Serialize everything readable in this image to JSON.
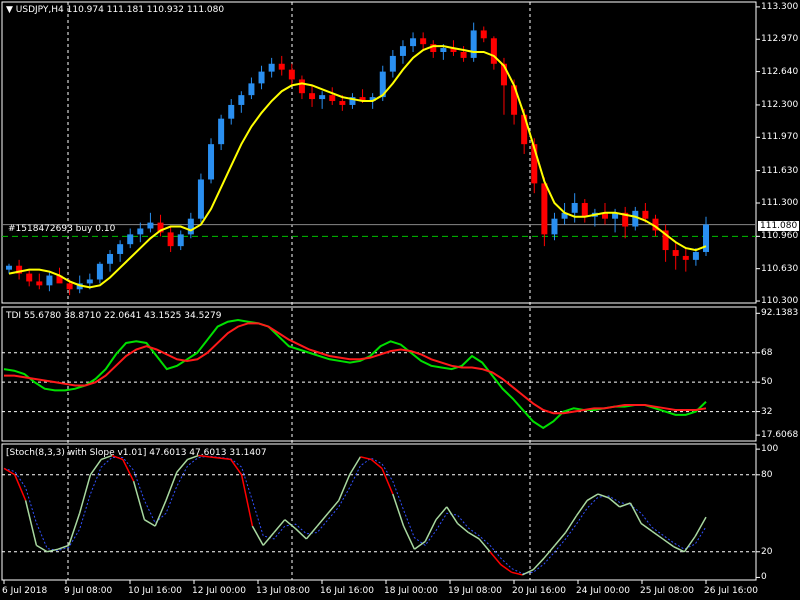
{
  "header": {
    "symbol": "USDJPY,H4",
    "ohlc": "110.974 111.181 110.932 111.080"
  },
  "order_label": "#1518472693 buy 0.10",
  "current_price": "111.080",
  "colors": {
    "bull": "#2a8ff0",
    "bear": "#ff0000",
    "ma": "#ffff00",
    "tdi_green": "#00e000",
    "tdi_red": "#ff1a1a",
    "stoch": "#a8d8a0",
    "signal": "#3050ff",
    "grid": "#ffffff"
  },
  "chart_data": [
    {
      "type": "candlestick",
      "title": "USDJPY,H4",
      "y_ticks": [
        "113.300",
        "112.970",
        "112.640",
        "112.300",
        "111.970",
        "111.630",
        "111.300",
        "110.960",
        "110.630",
        "110.300"
      ],
      "ylim": [
        110.28,
        113.35
      ],
      "candles": [
        [
          110.62,
          110.68,
          110.58,
          110.66
        ],
        [
          110.66,
          110.72,
          110.52,
          110.58
        ],
        [
          110.58,
          110.62,
          110.45,
          110.5
        ],
        [
          110.5,
          110.58,
          110.42,
          110.46
        ],
        [
          110.46,
          110.6,
          110.4,
          110.56
        ],
        [
          110.56,
          110.64,
          110.5,
          110.48
        ],
        [
          110.48,
          110.52,
          110.36,
          110.42
        ],
        [
          110.42,
          110.56,
          110.38,
          110.48
        ],
        [
          110.48,
          110.58,
          110.42,
          110.52
        ],
        [
          110.52,
          110.7,
          110.48,
          110.68
        ],
        [
          110.68,
          110.82,
          110.6,
          110.78
        ],
        [
          110.78,
          110.92,
          110.7,
          110.88
        ],
        [
          110.88,
          111.04,
          110.84,
          110.98
        ],
        [
          110.98,
          111.1,
          110.9,
          111.04
        ],
        [
          111.04,
          111.2,
          111.0,
          111.1
        ],
        [
          111.1,
          111.18,
          110.96,
          111.0
        ],
        [
          111.0,
          111.06,
          110.8,
          110.86
        ],
        [
          110.86,
          111.02,
          110.82,
          110.98
        ],
        [
          110.98,
          111.2,
          110.94,
          111.14
        ],
        [
          111.14,
          111.6,
          111.1,
          111.54
        ],
        [
          111.54,
          111.96,
          111.5,
          111.9
        ],
        [
          111.9,
          112.2,
          111.84,
          112.16
        ],
        [
          112.16,
          112.36,
          112.1,
          112.3
        ],
        [
          112.3,
          112.44,
          112.22,
          112.4
        ],
        [
          112.4,
          112.58,
          112.36,
          112.52
        ],
        [
          112.52,
          112.7,
          112.46,
          112.64
        ],
        [
          112.64,
          112.78,
          112.58,
          112.72
        ],
        [
          112.72,
          112.8,
          112.6,
          112.66
        ],
        [
          112.66,
          112.72,
          112.5,
          112.56
        ],
        [
          112.56,
          112.6,
          112.36,
          112.42
        ],
        [
          112.42,
          112.5,
          112.28,
          112.36
        ],
        [
          112.36,
          112.44,
          112.26,
          112.4
        ],
        [
          112.4,
          112.48,
          112.3,
          112.34
        ],
        [
          112.34,
          112.4,
          112.24,
          112.3
        ],
        [
          112.3,
          112.42,
          112.26,
          112.38
        ],
        [
          112.38,
          112.46,
          112.32,
          112.34
        ],
        [
          112.34,
          112.42,
          112.26,
          112.38
        ],
        [
          112.38,
          112.7,
          112.34,
          112.64
        ],
        [
          112.64,
          112.86,
          112.58,
          112.8
        ],
        [
          112.8,
          112.96,
          112.72,
          112.9
        ],
        [
          112.9,
          113.04,
          112.84,
          112.98
        ],
        [
          112.98,
          113.04,
          112.86,
          112.92
        ],
        [
          112.92,
          112.96,
          112.78,
          112.84
        ],
        [
          112.84,
          112.92,
          112.76,
          112.88
        ],
        [
          112.88,
          112.96,
          112.8,
          112.84
        ],
        [
          112.84,
          112.9,
          112.74,
          112.78
        ],
        [
          112.78,
          113.14,
          112.74,
          113.06
        ],
        [
          113.06,
          113.1,
          112.94,
          112.98
        ],
        [
          112.98,
          113.0,
          112.66,
          112.72
        ],
        [
          112.72,
          112.78,
          112.2,
          112.5
        ],
        [
          112.5,
          112.56,
          112.1,
          112.2
        ],
        [
          112.2,
          112.26,
          111.8,
          111.9
        ],
        [
          111.9,
          111.96,
          111.4,
          111.5
        ],
        [
          111.5,
          111.56,
          110.86,
          110.98
        ],
        [
          110.98,
          111.2,
          110.92,
          111.14
        ],
        [
          111.14,
          111.3,
          111.08,
          111.2
        ],
        [
          111.2,
          111.4,
          111.1,
          111.3
        ],
        [
          111.3,
          111.34,
          111.1,
          111.16
        ],
        [
          111.16,
          111.24,
          111.06,
          111.2
        ],
        [
          111.2,
          111.3,
          111.08,
          111.14
        ],
        [
          111.14,
          111.24,
          111.0,
          111.2
        ],
        [
          111.2,
          111.26,
          110.94,
          111.06
        ],
        [
          111.06,
          111.26,
          111.02,
          111.22
        ],
        [
          111.22,
          111.3,
          111.1,
          111.14
        ],
        [
          111.14,
          111.18,
          110.96,
          111.02
        ],
        [
          111.02,
          111.08,
          110.7,
          110.82
        ],
        [
          110.82,
          110.9,
          110.62,
          110.76
        ],
        [
          110.76,
          110.84,
          110.6,
          110.72
        ],
        [
          110.72,
          110.84,
          110.66,
          110.8
        ],
        [
          110.8,
          111.16,
          110.76,
          111.08
        ]
      ],
      "ma": [
        110.58,
        110.6,
        110.62,
        110.62,
        110.6,
        110.56,
        110.5,
        110.46,
        110.44,
        110.46,
        110.54,
        110.64,
        110.74,
        110.84,
        110.94,
        111.02,
        111.06,
        111.06,
        111.02,
        111.08,
        111.24,
        111.46,
        111.68,
        111.9,
        112.08,
        112.22,
        112.34,
        112.44,
        112.5,
        112.52,
        112.5,
        112.46,
        112.42,
        112.38,
        112.36,
        112.34,
        112.34,
        112.4,
        112.52,
        112.66,
        112.78,
        112.86,
        112.9,
        112.9,
        112.88,
        112.86,
        112.84,
        112.84,
        112.8,
        112.7,
        112.5,
        112.2,
        111.86,
        111.52,
        111.3,
        111.2,
        111.16,
        111.16,
        111.18,
        111.2,
        111.2,
        111.18,
        111.16,
        111.12,
        111.06,
        110.98,
        110.9,
        110.84,
        110.82,
        110.86
      ]
    },
    {
      "type": "line",
      "title": "TDI 55.6780 38.8710 22.0641 43.1525 34.5279",
      "y_ticks": [
        "92.1383",
        "68",
        "50",
        "32",
        "17.6068"
      ],
      "ylim": [
        14,
        96
      ],
      "series": [
        {
          "values": [
            58,
            57,
            55,
            50,
            46,
            45,
            45,
            46,
            48,
            52,
            58,
            67,
            74,
            75,
            74,
            66,
            58,
            60,
            64,
            68,
            76,
            84,
            87,
            88,
            87,
            86,
            84,
            78,
            72,
            70,
            68,
            66,
            64,
            63,
            62,
            63,
            66,
            72,
            75,
            73,
            68,
            63,
            60,
            59,
            58,
            60,
            66,
            62,
            54,
            46,
            40,
            33,
            26,
            22,
            26,
            32,
            34,
            33,
            33,
            34,
            35,
            35,
            36,
            36,
            34,
            32,
            30,
            30,
            32,
            38
          ]
        },
        {
          "values": [
            54,
            54,
            53,
            52,
            51,
            50,
            49,
            48,
            48,
            50,
            54,
            60,
            66,
            70,
            72,
            70,
            67,
            64,
            63,
            64,
            68,
            74,
            80,
            84,
            86,
            86,
            84,
            80,
            76,
            73,
            70,
            68,
            66,
            65,
            64,
            64,
            65,
            67,
            69,
            70,
            69,
            67,
            64,
            62,
            60,
            59,
            59,
            58,
            56,
            52,
            47,
            42,
            37,
            33,
            31,
            31,
            32,
            33,
            34,
            34,
            35,
            36,
            36,
            36,
            35,
            34,
            33,
            33,
            33,
            34
          ]
        }
      ]
    },
    {
      "type": "line",
      "title": "[Stoch(8,3,3) with Slope v1.01] 47.6013 47.6013 31.1407",
      "y_ticks": [
        "100",
        "80",
        "20",
        "0"
      ],
      "ylim": [
        -2,
        104
      ],
      "series": [
        {
          "values": [
            85,
            80,
            60,
            25,
            20,
            22,
            25,
            50,
            80,
            92,
            95,
            92,
            75,
            45,
            40,
            60,
            82,
            92,
            95,
            94,
            93,
            92,
            80,
            40,
            25,
            35,
            45,
            38,
            30,
            40,
            50,
            60,
            80,
            94,
            92,
            85,
            65,
            40,
            22,
            28,
            45,
            55,
            42,
            35,
            30,
            20,
            10,
            4,
            2,
            6,
            15,
            25,
            35,
            48,
            60,
            65,
            62,
            55,
            58,
            42,
            36,
            30,
            24,
            20,
            32,
            47
          ]
        }
      ]
    }
  ],
  "x_labels": [
    "6 Jul 2018",
    "9 Jul 08:00",
    "10 Jul 16:00",
    "12 Jul 00:00",
    "13 Jul 08:00",
    "16 Jul 16:00",
    "18 Jul 00:00",
    "19 Jul 08:00",
    "20 Jul 16:00",
    "24 Jul 00:00",
    "25 Jul 08:00",
    "26 Jul 16:00"
  ]
}
